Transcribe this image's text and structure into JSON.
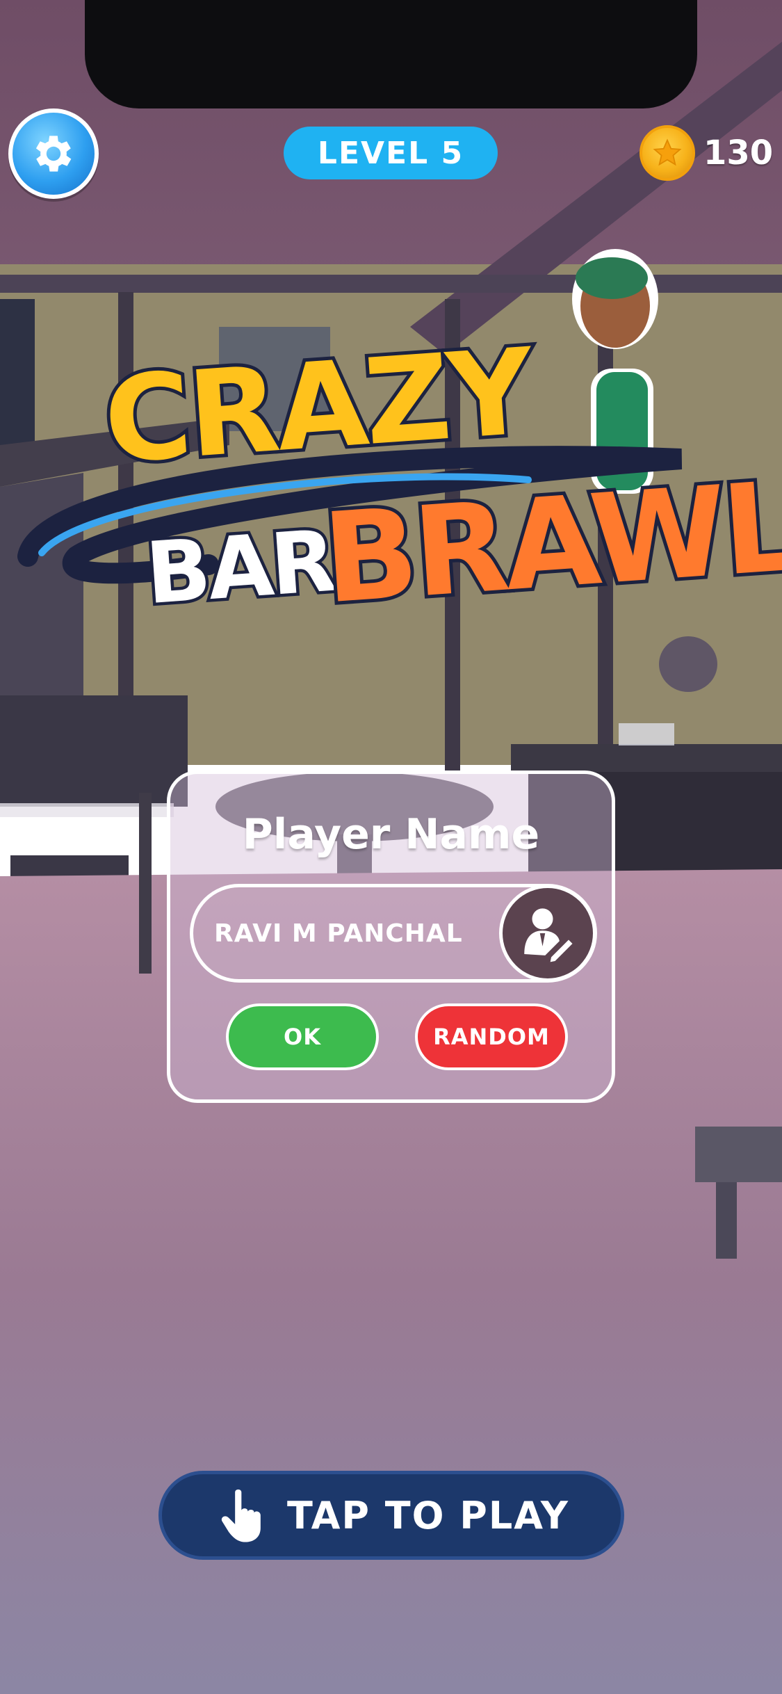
{
  "header": {
    "level_label": "LEVEL 5",
    "coin_count": "130",
    "settings_icon": "gear-icon",
    "coin_icon": "coin-star-icon"
  },
  "logo": {
    "line1": "CRAZY",
    "line2a": "BAR",
    "line2b": "BRAWL"
  },
  "name_panel": {
    "title": "Player Name",
    "name_value": "RAVI M PANCHAL",
    "edit_icon": "edit-profile-icon",
    "ok_label": "OK",
    "random_label": "RANDOM"
  },
  "play": {
    "label": "TAP TO PLAY",
    "icon": "pointing-hand-icon"
  },
  "colors": {
    "level_pill": "#1fb2f2",
    "ok_green": "#3dbb4e",
    "random_red": "#ee3338",
    "play_navy": "#1c386b",
    "logo_yellow": "#ffc21c",
    "logo_orange": "#ff7a2e"
  }
}
